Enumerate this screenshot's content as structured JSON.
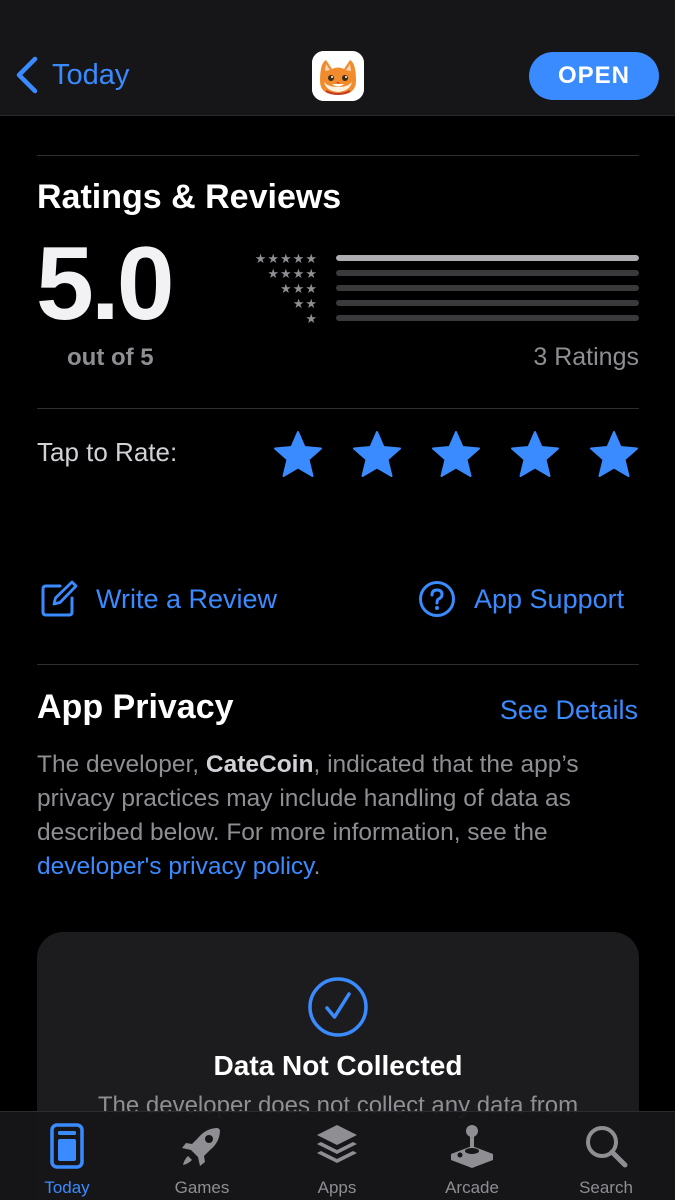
{
  "nav": {
    "back_label": "Today",
    "open_label": "OPEN"
  },
  "ratings": {
    "title": "Ratings & Reviews",
    "score": "5.0",
    "out_of": "out of 5",
    "count_label": "3 Ratings",
    "distribution": [
      {
        "stars": 5,
        "fraction": 1.0
      },
      {
        "stars": 4,
        "fraction": 0
      },
      {
        "stars": 3,
        "fraction": 0
      },
      {
        "stars": 2,
        "fraction": 0
      },
      {
        "stars": 1,
        "fraction": 0
      }
    ],
    "tap_to_rate": "Tap to Rate:"
  },
  "actions": {
    "write_review": "Write a Review",
    "app_support": "App Support"
  },
  "privacy": {
    "title": "App Privacy",
    "see_details": "See Details",
    "text_prefix": "The developer, ",
    "developer": "CateCoin",
    "text_mid": ", indicated that the app’s privacy practices may include handling of data as described below. For more information, see the ",
    "policy_link": "developer's privacy policy",
    "text_suffix": ".",
    "card_title": "Data Not Collected",
    "card_desc": "The developer does not collect any data from"
  },
  "tabbar": {
    "items": [
      {
        "label": "Today",
        "icon": "today-icon",
        "active": true
      },
      {
        "label": "Games",
        "icon": "rocket-icon",
        "active": false
      },
      {
        "label": "Apps",
        "icon": "layers-icon",
        "active": false
      },
      {
        "label": "Arcade",
        "icon": "joystick-icon",
        "active": false
      },
      {
        "label": "Search",
        "icon": "search-icon",
        "active": false
      }
    ]
  },
  "colors": {
    "accent": "#3a8bff",
    "background": "#000000",
    "nav_background": "#161618",
    "card_background": "#1c1c1e",
    "secondary_text": "#8e8e93"
  }
}
